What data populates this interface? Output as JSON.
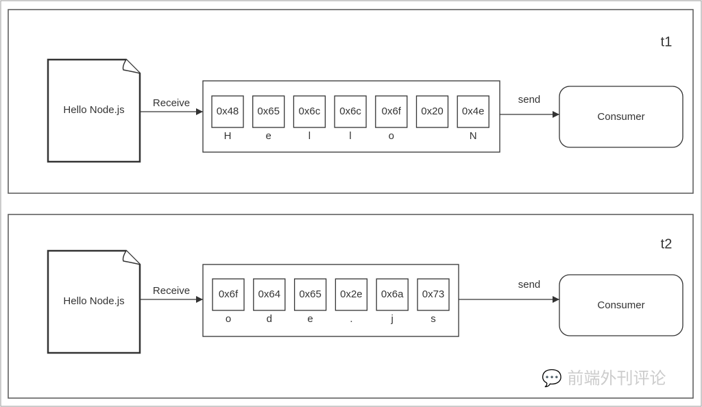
{
  "panels": [
    {
      "label": "t1",
      "document": "Hello Node.js",
      "receive_label": "Receive",
      "send_label": "send",
      "consumer": "Consumer",
      "bytes": [
        {
          "hex": "0x48",
          "char": "H"
        },
        {
          "hex": "0x65",
          "char": "e"
        },
        {
          "hex": "0x6c",
          "char": "l"
        },
        {
          "hex": "0x6c",
          "char": "l"
        },
        {
          "hex": "0x6f",
          "char": "o"
        },
        {
          "hex": "0x20",
          "char": ""
        },
        {
          "hex": "0x4e",
          "char": "N"
        }
      ]
    },
    {
      "label": "t2",
      "document": "Hello Node.js",
      "receive_label": "Receive",
      "send_label": "send",
      "consumer": "Consumer",
      "bytes": [
        {
          "hex": "0x6f",
          "char": "o"
        },
        {
          "hex": "0x64",
          "char": "d"
        },
        {
          "hex": "0x65",
          "char": "e"
        },
        {
          "hex": "0x2e",
          "char": "."
        },
        {
          "hex": "0x6a",
          "char": "j"
        },
        {
          "hex": "0x73",
          "char": "s"
        }
      ]
    }
  ],
  "watermark": "前端外刊评论",
  "colors": {
    "stroke": "#333333",
    "panel_border": "#555555"
  }
}
